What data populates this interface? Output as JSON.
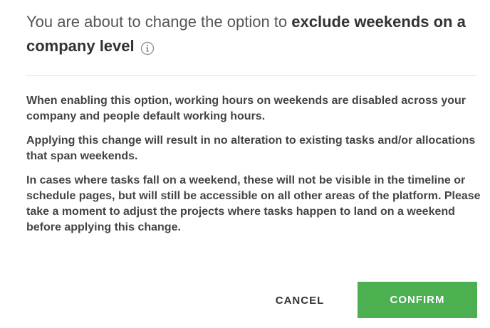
{
  "dialog": {
    "title_prefix": "You are about to change the option to ",
    "title_bold": "exclude weekends on a company level",
    "info_icon": "info-icon",
    "paragraphs": [
      "When enabling this option, working hours on weekends are disabled across your company and people default working hours.",
      "Applying this change will result in no alteration to existing tasks and/or allocations that span weekends.",
      "In cases where tasks fall on a weekend, these will not be visible in the timeline or schedule pages, but will still be accessible on all other areas of the platform. Please take a moment to adjust the projects where tasks happen to land on a weekend before applying this change."
    ],
    "cancel_label": "CANCEL",
    "confirm_label": "CONFIRM",
    "confirm_color": "#4caf50"
  }
}
